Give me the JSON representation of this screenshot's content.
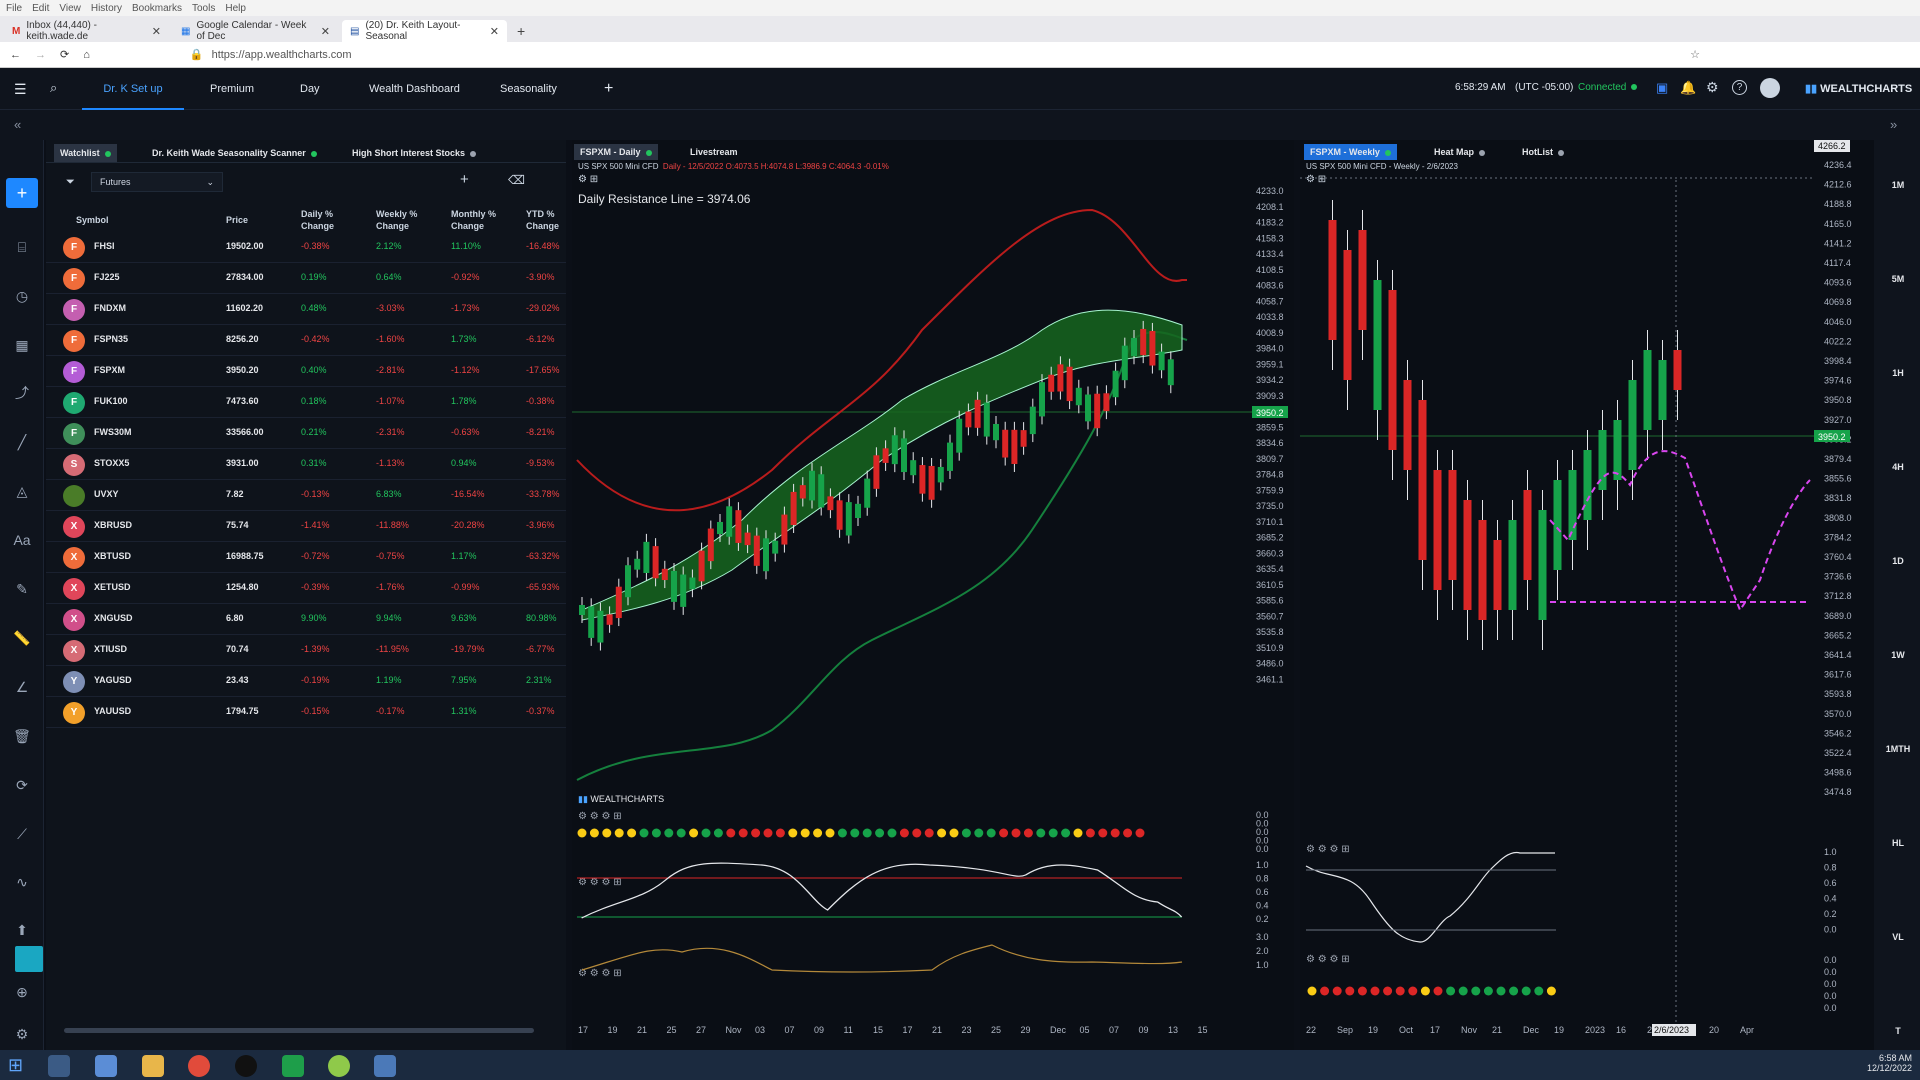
{
  "browser": {
    "menu": [
      "File",
      "Edit",
      "View",
      "History",
      "Bookmarks",
      "Tools",
      "Help"
    ],
    "tabs": [
      {
        "label": "Inbox (44,440) - keith.wade.de"
      },
      {
        "label": "Google Calendar - Week of Dec"
      },
      {
        "label": "(20) Dr. Keith Layout-Seasonal"
      }
    ],
    "url": "https://app.wealthcharts.com"
  },
  "header": {
    "tabs": [
      "Dr. K Set up",
      "Premium",
      "Day",
      "Wealth Dashboard",
      "Seasonality"
    ],
    "time": "6:58:29 AM",
    "tz": "(UTC -05:00)",
    "status": "Connected",
    "brand": "WEALTHCHARTS"
  },
  "watchlist": {
    "tabs": [
      "Watchlist",
      "Dr. Keith Wade Seasonality Scanner",
      "High Short Interest Stocks"
    ],
    "filter": "Futures",
    "columns": [
      "Symbol",
      "Price",
      "Daily % Change",
      "Weekly % Change",
      "Monthly % Change",
      "YTD % Change"
    ],
    "rows": [
      {
        "letter": "F",
        "color": "#ef6c3a",
        "symbol": "FHSI",
        "price": "19502.00",
        "d": "-0.38%",
        "w": "2.12%",
        "m": "11.10%",
        "y": "-16.48%"
      },
      {
        "letter": "F",
        "color": "#ef6c3a",
        "symbol": "FJ225",
        "price": "27834.00",
        "d": "0.19%",
        "w": "0.64%",
        "m": "-0.92%",
        "y": "-3.90%"
      },
      {
        "letter": "F",
        "color": "#c45fb0",
        "symbol": "FNDXM",
        "price": "11602.20",
        "d": "0.48%",
        "w": "-3.03%",
        "m": "-1.73%",
        "y": "-29.02%"
      },
      {
        "letter": "F",
        "color": "#ef6c3a",
        "symbol": "FSPN35",
        "price": "8256.20",
        "d": "-0.42%",
        "w": "-1.60%",
        "m": "1.73%",
        "y": "-6.12%"
      },
      {
        "letter": "F",
        "color": "#b45cd6",
        "symbol": "FSPXM",
        "price": "3950.20",
        "d": "0.40%",
        "w": "-2.81%",
        "m": "-1.12%",
        "y": "-17.65%"
      },
      {
        "letter": "F",
        "color": "#1fa971",
        "symbol": "FUK100",
        "price": "7473.60",
        "d": "0.18%",
        "w": "-1.07%",
        "m": "1.78%",
        "y": "-0.38%"
      },
      {
        "letter": "F",
        "color": "#3f8f5a",
        "symbol": "FWS30M",
        "price": "33566.00",
        "d": "0.21%",
        "w": "-2.31%",
        "m": "-0.63%",
        "y": "-8.21%"
      },
      {
        "letter": "S",
        "color": "#d66b75",
        "symbol": "STOXX5",
        "price": "3931.00",
        "d": "0.31%",
        "w": "-1.13%",
        "m": "0.94%",
        "y": "-9.53%"
      },
      {
        "letter": "",
        "color": "#4a7c28",
        "symbol": "UVXY",
        "price": "7.82",
        "d": "-0.13%",
        "w": "6.83%",
        "m": "-16.54%",
        "y": "-33.78%"
      },
      {
        "letter": "X",
        "color": "#e0465a",
        "symbol": "XBRUSD",
        "price": "75.74",
        "d": "-1.41%",
        "w": "-11.88%",
        "m": "-20.28%",
        "y": "-3.96%"
      },
      {
        "letter": "X",
        "color": "#ef6c3a",
        "symbol": "XBTUSD",
        "price": "16988.75",
        "d": "-0.72%",
        "w": "-0.75%",
        "m": "1.17%",
        "y": "-63.32%"
      },
      {
        "letter": "X",
        "color": "#e0465a",
        "symbol": "XETUSD",
        "price": "1254.80",
        "d": "-0.39%",
        "w": "-1.76%",
        "m": "-0.99%",
        "y": "-65.93%"
      },
      {
        "letter": "X",
        "color": "#d14f8a",
        "symbol": "XNGUSD",
        "price": "6.80",
        "d": "9.90%",
        "w": "9.94%",
        "m": "9.63%",
        "y": "80.98%"
      },
      {
        "letter": "X",
        "color": "#d66b75",
        "symbol": "XTIUSD",
        "price": "70.74",
        "d": "-1.39%",
        "w": "-11.95%",
        "m": "-19.79%",
        "y": "-6.77%"
      },
      {
        "letter": "Y",
        "color": "#7e8fb5",
        "symbol": "YAGUSD",
        "price": "23.43",
        "d": "-0.19%",
        "w": "1.19%",
        "m": "7.95%",
        "y": "2.31%"
      },
      {
        "letter": "Y",
        "color": "#f2a02a",
        "symbol": "YAUUSD",
        "price": "1794.75",
        "d": "-0.15%",
        "w": "-0.17%",
        "m": "1.31%",
        "y": "-0.37%"
      }
    ]
  },
  "daily_chart": {
    "tabs": [
      "FSPXM - Daily",
      "Livestream"
    ],
    "title": "US SPX 500 Mini CFD",
    "ohlc": "Daily - 12/5/2022 O:4073.5 H:4074.8 L:3986.9 C:4064.3 -0.01%",
    "annotation": "Daily Resistance Line = 3974.06",
    "price_label": "3950.2",
    "logo": "WEALTHCHARTS",
    "y_ticks": [
      "4233.0",
      "4208.1",
      "4183.2",
      "4158.3",
      "4133.4",
      "4108.5",
      "4083.6",
      "4058.7",
      "4033.8",
      "4008.9",
      "3984.0",
      "3959.1",
      "3934.2",
      "3909.3",
      "3884.4",
      "3859.5",
      "3834.6",
      "3809.7",
      "3784.8",
      "3759.9",
      "3735.0",
      "3710.1",
      "3685.2",
      "3660.3",
      "3635.4",
      "3610.5",
      "3585.6",
      "3560.7",
      "3535.8",
      "3510.9",
      "3486.0",
      "3461.1"
    ],
    "x_ticks": [
      "17",
      "19",
      "21",
      "25",
      "27",
      "Nov",
      "03",
      "07",
      "09",
      "11",
      "15",
      "17",
      "21",
      "23",
      "25",
      "29",
      "Dec",
      "05",
      "07",
      "09",
      "13",
      "15"
    ],
    "osc_ticks_a": [
      "0.0",
      "0.0",
      "0.0",
      "0.0",
      "0.0"
    ],
    "osc_ticks_b": [
      "1.0",
      "0.8",
      "0.6",
      "0.4",
      "0.2"
    ],
    "osc_ticks_c": [
      "3.0",
      "2.0",
      "1.0"
    ],
    "dots": [
      "y",
      "y",
      "y",
      "y",
      "y",
      "g",
      "g",
      "g",
      "g",
      "y",
      "g",
      "g",
      "r",
      "r",
      "r",
      "r",
      "r",
      "y",
      "y",
      "y",
      "y",
      "g",
      "g",
      "g",
      "g",
      "g",
      "r",
      "r",
      "r",
      "y",
      "y",
      "g",
      "g",
      "g",
      "r",
      "r",
      "r",
      "g",
      "g",
      "g",
      "y",
      "r",
      "r",
      "r",
      "r",
      "r"
    ]
  },
  "weekly_chart": {
    "tabs": [
      "FSPXM - Weekly",
      "Heat Map",
      "HotList"
    ],
    "title": "US SPX 500 Mini CFD",
    "subtitle": "Weekly - 2/6/2023",
    "crosshair_price": "4266.2",
    "price_label": "3950.2",
    "date_label": "2/6/2023",
    "y_ticks": [
      "4236.4",
      "4212.6",
      "4188.8",
      "4165.0",
      "4141.2",
      "4117.4",
      "4093.6",
      "4069.8",
      "4046.0",
      "4022.2",
      "3998.4",
      "3974.6",
      "3950.8",
      "3927.0",
      "3903.2",
      "3879.4",
      "3855.6",
      "3831.8",
      "3808.0",
      "3784.2",
      "3760.4",
      "3736.6",
      "3712.8",
      "3689.0",
      "3665.2",
      "3641.4",
      "3617.6",
      "3593.8",
      "3570.0",
      "3546.2",
      "3522.4",
      "3498.6",
      "3474.8"
    ],
    "x_ticks": [
      "22",
      "Sep",
      "19",
      "Oct",
      "17",
      "Nov",
      "21",
      "Dec",
      "19",
      "2023",
      "16",
      "20",
      "Mar",
      "20",
      "Apr"
    ],
    "osc_ticks_a": [
      "1.0",
      "0.8",
      "0.6",
      "0.4",
      "0.2",
      "0.0"
    ],
    "osc_ticks_b": [
      "0.0",
      "0.0",
      "0.0",
      "0.0",
      "0.0"
    ],
    "dots": [
      "y",
      "r",
      "r",
      "r",
      "r",
      "r",
      "r",
      "r",
      "r",
      "y",
      "r",
      "g",
      "g",
      "g",
      "g",
      "g",
      "g",
      "g",
      "g",
      "y"
    ],
    "timeframes": [
      "1M",
      "5M",
      "1H",
      "4H",
      "1D",
      "1W",
      "1MTH",
      "HL",
      "VL",
      "T"
    ]
  },
  "taskbar": {
    "time": "6:58 AM",
    "date": "12/12/2022"
  }
}
